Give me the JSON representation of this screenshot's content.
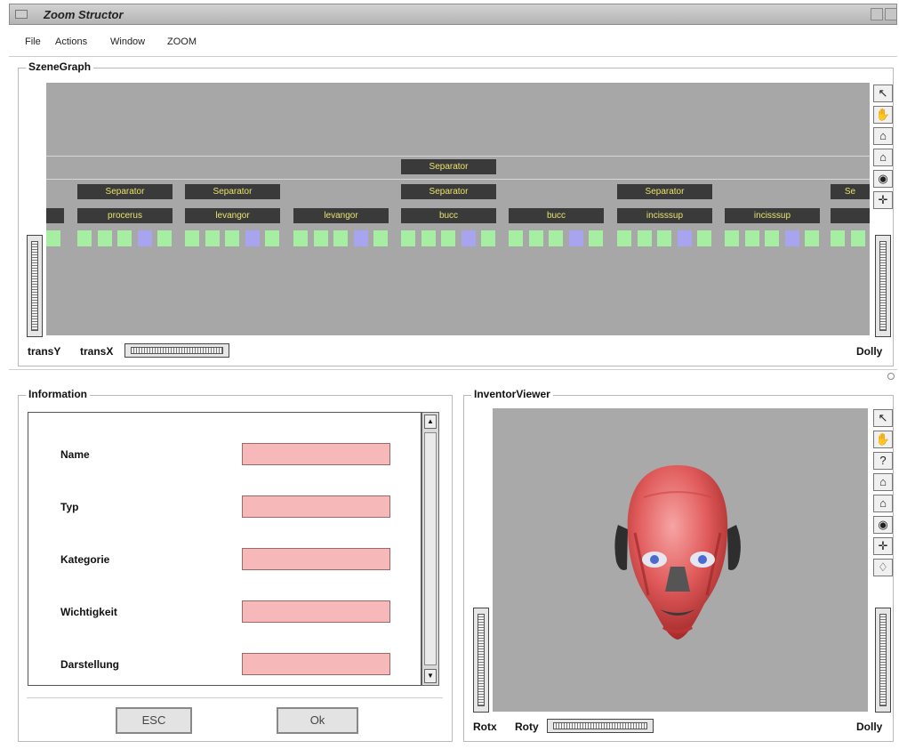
{
  "window": {
    "title": "Zoom Structor"
  },
  "menu": [
    "File",
    "Actions",
    "Window",
    "ZOOM"
  ],
  "scenegraph": {
    "title": "SzeneGraph",
    "top_node": "Separator",
    "separators": [
      "Separator",
      "Separator",
      "Separator",
      "Separator",
      "Se"
    ],
    "nodes": [
      "procerus",
      "levangor",
      "levangor",
      "bucc",
      "bucc",
      "incisssup",
      "incisssup"
    ],
    "labels": {
      "trans_y": "transY",
      "trans_x": "transX",
      "dolly": "Dolly"
    }
  },
  "information": {
    "title": "Information",
    "fields": [
      {
        "label": "Name",
        "value": ""
      },
      {
        "label": "Typ",
        "value": ""
      },
      {
        "label": "Kategorie",
        "value": ""
      },
      {
        "label": "Wichtigkeit",
        "value": ""
      },
      {
        "label": "Darstellung",
        "value": ""
      }
    ],
    "buttons": {
      "esc": "ESC",
      "ok": "Ok"
    }
  },
  "viewer": {
    "title": "InventorViewer",
    "labels": {
      "rotx": "Rotx",
      "roty": "Roty",
      "dolly": "Dolly"
    }
  },
  "colors": {
    "node_bg": "#3a3a3a",
    "node_text": "#e9e36a",
    "leaf_green": "#a6eea2",
    "leaf_purple": "#a8a4f0",
    "field_pink": "#f6b8b8",
    "canvas_gray": "#a7a7a7"
  },
  "icons": {
    "scenegraph_toolbar": [
      "arrow-pointer-icon",
      "hand-icon",
      "home-icon",
      "set-home-icon",
      "eye-icon",
      "crosshair-icon"
    ],
    "viewer_toolbar": [
      "arrow-pointer-icon",
      "hand-icon",
      "help-icon",
      "home-icon",
      "set-home-icon",
      "eye-icon",
      "crosshair-icon",
      "perspective-icon"
    ]
  }
}
